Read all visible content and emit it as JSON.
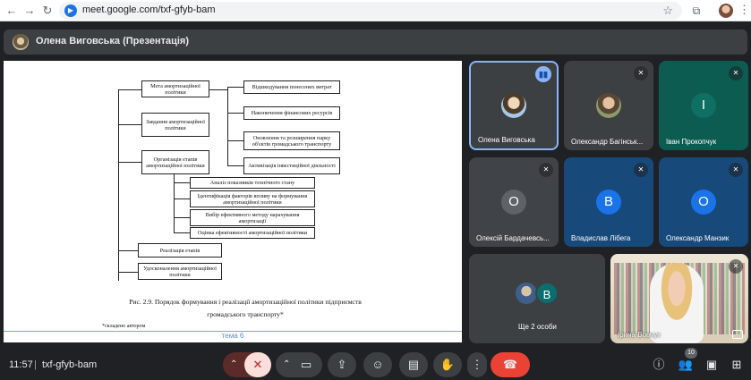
{
  "browser": {
    "url": "meet.google.com/txf-gfyb-bam",
    "back_icon": "arrow-back-icon",
    "forward_icon": "arrow-forward-icon",
    "reload_icon": "reload-icon"
  },
  "presenter": {
    "title": "Олена Виговська (Презентація)"
  },
  "slide": {
    "boxes": {
      "goal": "Мета амортизаційної політики",
      "tasks": "Завдання амортизаційної політики",
      "stages_org": "Організація етапів амортизаційної політики",
      "recovery": "Відшкодування понесених витрат",
      "accumulation": "Накопичення фінансових ресурсів",
      "renewal": "Оновлення та розширення парку об'єктів громадського транспорту",
      "investment": "Активізація інвестиційної діяльності",
      "analysis": "Аналіз показників технічного стану",
      "factors": "Ідентифікація факторів впливу на формування амортизаційної політики",
      "method": "Вибір ефективного методу нарахування амортизації",
      "evaluation": "Оцінка ефективності амортизаційної політики",
      "implementation": "Реалізація етапів",
      "improvement": "Удосконалення амортизаційної політики"
    },
    "caption_line1": "Рис. 2.9. Порядок формування і реалізації амортизаційної політики підприємств",
    "caption_line2": "громадського транспорту*",
    "footnote": "*складено автором",
    "footer": "тема 6"
  },
  "participants": [
    {
      "name": "Олена Виговська",
      "initial": "",
      "color": "",
      "speaking": true
    },
    {
      "name": "Олександр Багінськ...",
      "initial": "",
      "color": "",
      "speaking": false
    },
    {
      "name": "Іван Прокопчук",
      "initial": "І",
      "color": "#0f6f62",
      "speaking": false
    },
    {
      "name": "Олексій Бардачевсь...",
      "initial": "О",
      "color": "#5f6368",
      "speaking": false
    },
    {
      "name": "Владислав Лібега",
      "initial": "В",
      "color": "#1a73e8",
      "speaking": false
    },
    {
      "name": "Олександр Манзик",
      "initial": "О",
      "color": "#1a73e8",
      "speaking": false
    }
  ],
  "more_tile": {
    "label": "Ще 2 особи",
    "initial": "В"
  },
  "self_tile": {
    "name": "Ірина Вовчук"
  },
  "bottom": {
    "time": "11:57",
    "separator": "|",
    "meeting_code": "txf-gfyb-bam",
    "people_count": "10"
  }
}
